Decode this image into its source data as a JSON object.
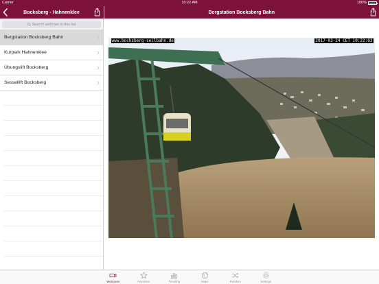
{
  "status_bar": {
    "carrier": "Carrier",
    "time": "10:22 AM",
    "battery": "100%"
  },
  "sidebar": {
    "title": "Bocksberg - Hahnenklee",
    "search_placeholder": "Search webcam in this list",
    "items": [
      {
        "label": "Bergstation Bocksberg Bahn",
        "selected": true
      },
      {
        "label": "Kurpark Hahnenklee",
        "selected": false
      },
      {
        "label": "Übungslift Bocksberg",
        "selected": false
      },
      {
        "label": "Sessellift Bocksberg",
        "selected": false
      }
    ]
  },
  "detail": {
    "title": "Bergstation Bocksberg Bahn",
    "webcam_caption": "www.bocksberg-seilbahn.de",
    "webcam_timestamp": "2017-03-24 CET 10:22:03"
  },
  "tabs": [
    {
      "label": "Webcams",
      "icon": "video-camera-icon",
      "active": true
    },
    {
      "label": "Favorites",
      "icon": "star-icon",
      "active": false
    },
    {
      "label": "Trending",
      "icon": "bar-chart-icon",
      "active": false
    },
    {
      "label": "Maps",
      "icon": "globe-icon",
      "active": false
    },
    {
      "label": "Random",
      "icon": "shuffle-icon",
      "active": false
    },
    {
      "label": "Settings",
      "icon": "gear-icon",
      "active": false
    }
  ],
  "colors": {
    "brand": "#7d1239",
    "active_tab": "#9b1747",
    "selected_row": "#d9d9d9"
  }
}
